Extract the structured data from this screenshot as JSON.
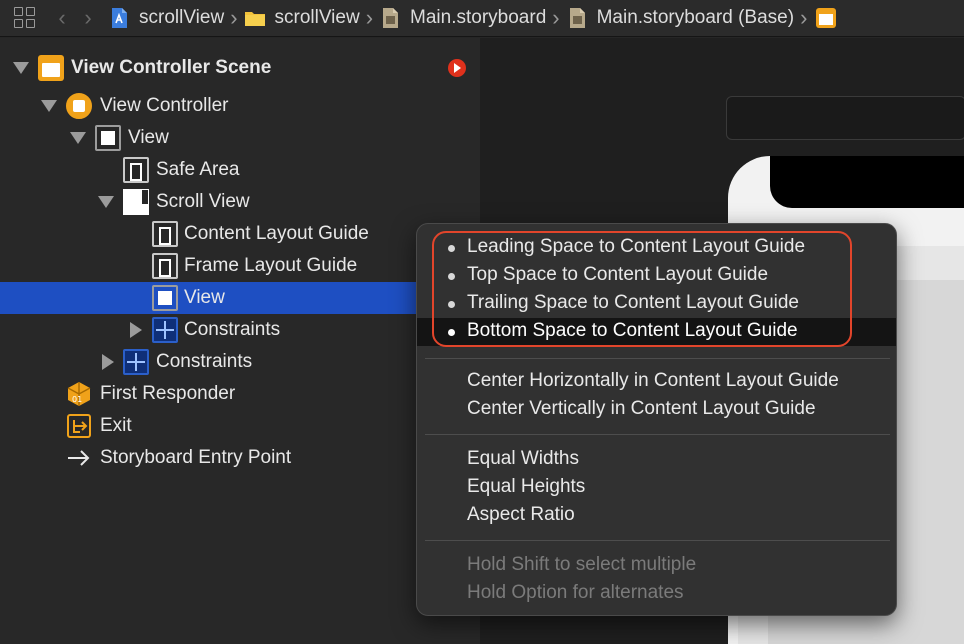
{
  "jumpbar": {
    "crumbs": [
      {
        "label": "scrollView",
        "icon": "app-project-icon"
      },
      {
        "label": "scrollView",
        "icon": "folder-icon"
      },
      {
        "label": "Main.storyboard",
        "icon": "storyboard-file-icon"
      },
      {
        "label": "Main.storyboard (Base)",
        "icon": "storyboard-file-icon"
      }
    ]
  },
  "outline": {
    "items": [
      {
        "label": "View Controller Scene",
        "icon": "scene-icon"
      },
      {
        "label": "View Controller",
        "icon": "view-controller-icon"
      },
      {
        "label": "View",
        "icon": "view-icon"
      },
      {
        "label": "Safe Area",
        "icon": "layout-guide-icon"
      },
      {
        "label": "Scroll View",
        "icon": "scroll-view-icon"
      },
      {
        "label": "Content Layout Guide",
        "icon": "layout-guide-icon"
      },
      {
        "label": "Frame Layout Guide",
        "icon": "layout-guide-icon"
      },
      {
        "label": "View",
        "icon": "view-icon",
        "selected": true
      },
      {
        "label": "Constraints",
        "icon": "constraints-icon"
      },
      {
        "label": "Constraints",
        "icon": "constraints-icon"
      },
      {
        "label": "First Responder",
        "icon": "first-responder-icon"
      },
      {
        "label": "Exit",
        "icon": "exit-icon"
      },
      {
        "label": "Storyboard Entry Point",
        "icon": "arrow-right-icon"
      }
    ]
  },
  "menu": {
    "group1": [
      "Leading Space to Content Layout Guide",
      "Top Space to Content Layout Guide",
      "Trailing Space to Content Layout Guide",
      "Bottom Space to Content Layout Guide"
    ],
    "group2": [
      "Center Horizontally in Content Layout Guide",
      "Center Vertically in Content Layout Guide"
    ],
    "group3": [
      "Equal Widths",
      "Equal Heights",
      "Aspect Ratio"
    ],
    "hints": [
      "Hold Shift to select multiple",
      "Hold Option for alternates"
    ],
    "highlighted_index": 3
  },
  "colors": {
    "selection": "#1e4fc2",
    "accent_orange": "#f0a21a",
    "annotation_red": "#e2452b"
  }
}
